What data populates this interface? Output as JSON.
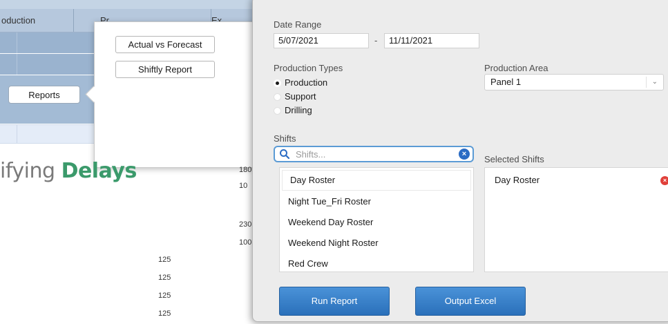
{
  "background": {
    "header_columns": [
      "oduction",
      "Pr",
      "Ex"
    ],
    "reports_button": "Reports",
    "popover": {
      "buttons": [
        "Actual vs Forecast",
        "Shiftly Report"
      ]
    },
    "heading": {
      "light": "ifying ",
      "strong": "Delays"
    },
    "numbers_right": [
      "180",
      "10",
      "230",
      "100"
    ],
    "numbers_center": [
      "125",
      "125",
      "125",
      "125"
    ]
  },
  "dialog": {
    "date_range": {
      "label": "Date Range",
      "start": "5/07/2021",
      "separator": "-",
      "end": "11/11/2021"
    },
    "production_types": {
      "label": "Production Types",
      "options": [
        "Production",
        "Support",
        "Drilling"
      ],
      "selected_index": 0
    },
    "production_area": {
      "label": "Production Area",
      "value": "Panel 1"
    },
    "shifts": {
      "label": "Shifts",
      "search_placeholder": "Shifts...",
      "items": [
        "Day Roster",
        "Night Tue_Fri Roster",
        "Weekend Day Roster",
        "Weekend Night Roster",
        "Red Crew"
      ]
    },
    "selected_shifts": {
      "label": "Selected Shifts",
      "items": [
        "Day Roster"
      ]
    },
    "buttons": {
      "run": "Run Report",
      "excel": "Output Excel"
    }
  },
  "colors": {
    "accent": "#2a70ba",
    "heading_strong": "#3b9a6b",
    "remove": "#e0403a"
  },
  "icons": [
    "search-icon",
    "clear-icon",
    "remove-icon",
    "chevron-down-icon"
  ]
}
